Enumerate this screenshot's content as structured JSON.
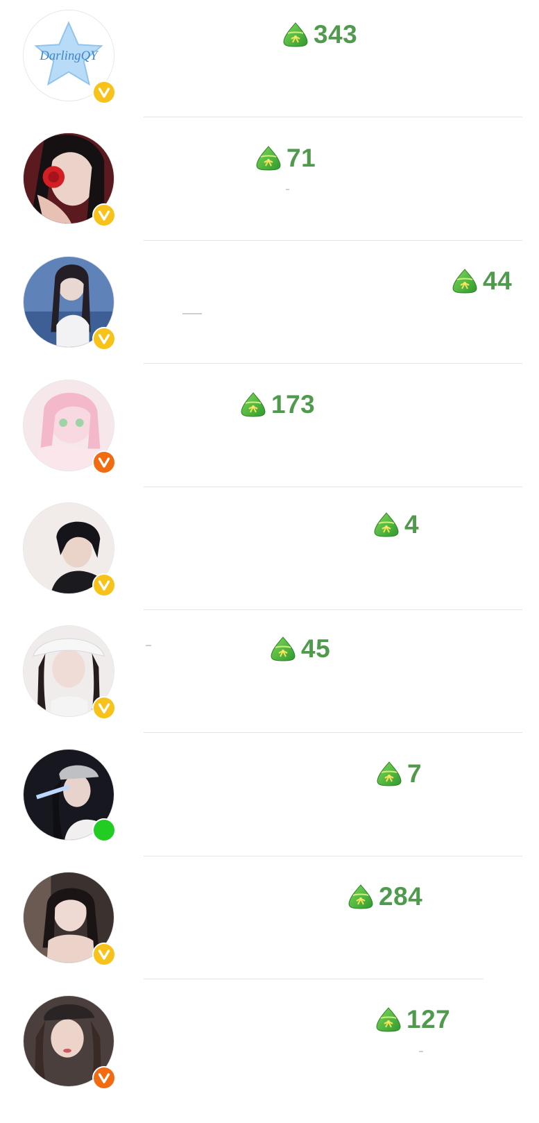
{
  "colors": {
    "count_text": "#4f9a4c",
    "badge_gold": "#f7c21a",
    "badge_orange": "#f06b12",
    "online_green": "#22cc22",
    "divider": "#e3e3e3"
  },
  "rows": [
    {
      "avatar_name": "avatar-darlingqy-star",
      "avatar_text": "DarlingQY",
      "badge": "gold-v-badge",
      "gift_icon": "zongzi-icon",
      "count": "343"
    },
    {
      "avatar_name": "avatar-girl-red-rose",
      "badge": "gold-v-badge",
      "gift_icon": "zongzi-icon",
      "count": "71"
    },
    {
      "avatar_name": "avatar-girl-blue-sea",
      "badge": "gold-v-badge",
      "gift_icon": "zongzi-icon",
      "count": "44"
    },
    {
      "avatar_name": "avatar-pink-anime-girl",
      "badge": "orange-v-badge",
      "gift_icon": "zongzi-icon",
      "count": "173"
    },
    {
      "avatar_name": "avatar-boy-black-hair",
      "badge": "gold-v-badge",
      "gift_icon": "zongzi-icon",
      "count": "4"
    },
    {
      "avatar_name": "avatar-girl-white-hat",
      "badge": "gold-v-badge",
      "gift_icon": "zongzi-icon",
      "count": "45"
    },
    {
      "avatar_name": "avatar-girl-cap-night",
      "badge": "online-dot",
      "gift_icon": "zongzi-icon",
      "count": "7"
    },
    {
      "avatar_name": "avatar-girl-chin-hands",
      "badge": "gold-v-badge",
      "gift_icon": "zongzi-icon",
      "count": "284"
    },
    {
      "avatar_name": "avatar-girl-dark-cap",
      "badge": "orange-v-badge",
      "gift_icon": "zongzi-icon",
      "count": "127"
    }
  ]
}
